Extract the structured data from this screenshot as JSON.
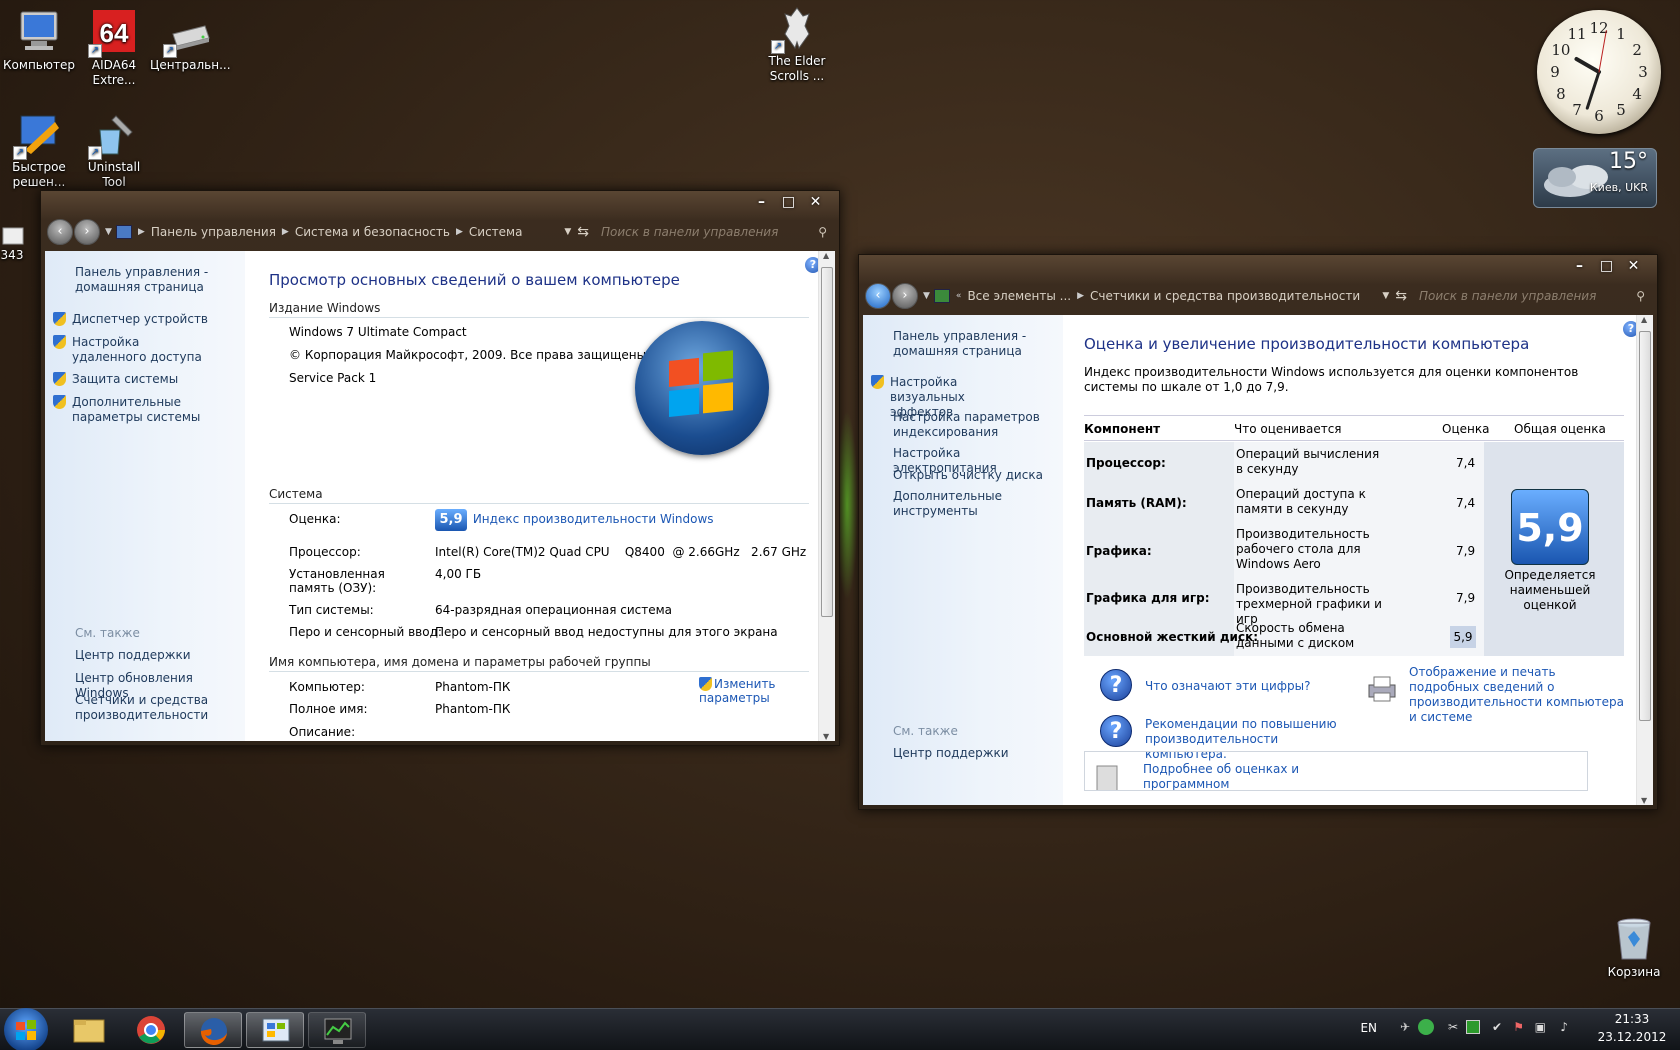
{
  "desktop": {
    "icons": [
      {
        "label": "Компьютер",
        "icon": "computer-icon"
      },
      {
        "label": "AIDA64 Extre...",
        "icon": "aida64-icon"
      },
      {
        "label": "Центральн...",
        "icon": "drive-icon"
      },
      {
        "label": "The Elder Scrolls ...",
        "icon": "skyrim-icon"
      },
      {
        "label": "Быстрое решен...",
        "icon": "quick-fix-icon"
      },
      {
        "label": "Uninstall Tool",
        "icon": "uninstall-tool-icon"
      },
      {
        "label": "343",
        "icon": "file-icon"
      },
      {
        "label": "Корзина",
        "icon": "recycle-bin-icon"
      }
    ],
    "clock_numbers": [
      "12",
      "1",
      "2",
      "3",
      "4",
      "5",
      "6",
      "7",
      "8",
      "9",
      "10",
      "11"
    ],
    "weather": {
      "temp": "15°",
      "city": "Киев, UKR"
    }
  },
  "system_window": {
    "breadcrumbs": [
      "Панель управления",
      "Система и безопасность",
      "Система"
    ],
    "search_placeholder": "Поиск в панели управления",
    "left": {
      "home": "Панель управления - домашняя страница",
      "tasks": [
        "Диспетчер устройств",
        "Настройка удаленного доступа",
        "Защита системы",
        "Дополнительные параметры системы"
      ],
      "see_also": "См. также",
      "see_also_links": [
        "Центр поддержки",
        "Центр обновления Windows",
        "Счетчики и средства производительности"
      ]
    },
    "title": "Просмотр основных сведений о вашем компьютере",
    "edition_header": "Издание Windows",
    "edition": "Windows 7 Ultimate Compact",
    "copyright": "© Корпорация Майкрософт, 2009. Все права защищены.",
    "service_pack": "Service Pack 1",
    "system_header": "Система",
    "rating_label": "Оценка:",
    "rating_value": "5,9",
    "rating_link": "Индекс производительности Windows",
    "cpu_label": "Процессор:",
    "cpu_value": "Intel(R) Core(TM)2 Quad CPU    Q8400  @ 2.66GHz   2.67 GHz",
    "ram_label": "Установленная память (ОЗУ):",
    "ram_value": "4,00 ГБ",
    "type_label": "Тип системы:",
    "type_value": "64-разрядная операционная система",
    "pen_label": "Перо и сенсорный ввод:",
    "pen_value": "Перо и сенсорный ввод недоступны для этого экрана",
    "name_header": "Имя компьютера, имя домена и параметры рабочей группы",
    "computer_label": "Компьютер:",
    "computer_value": "Phantom-ПК",
    "fullname_label": "Полное имя:",
    "fullname_value": "Phantom-ПК",
    "desc_label": "Описание:",
    "change_link": "Изменить параметры"
  },
  "perf_window": {
    "breadcrumbs": [
      "Все элементы ...",
      "Счетчики и средства производительности"
    ],
    "search_placeholder": "Поиск в панели управления",
    "left": {
      "home": "Панель управления - домашняя страница",
      "tasks": [
        "Настройка визуальных эффектов",
        "Настройка параметров индексирования",
        "Настройка электропитания",
        "Открыть очистку диска",
        "Дополнительные инструменты"
      ],
      "see_also": "См. также",
      "see_also_links": [
        "Центр поддержки"
      ]
    },
    "title": "Оценка и увеличение производительности компьютера",
    "intro": "Индекс производительности Windows используется для оценки компонентов системы по шкале от 1,0 до 7,9.",
    "headers": [
      "Компонент",
      "Что оценивается",
      "Оценка",
      "Общая оценка"
    ],
    "rows": [
      {
        "component": "Процессор:",
        "what": "Операций вычисления в секунду",
        "score": "7,4"
      },
      {
        "component": "Память (RAM):",
        "what": "Операций доступа к памяти в секунду",
        "score": "7,4"
      },
      {
        "component": "Графика:",
        "what": "Производительность рабочего стола для Windows Aero",
        "score": "7,9"
      },
      {
        "component": "Графика для игр:",
        "what": "Производительность трехмерной графики и игр",
        "score": "7,9"
      },
      {
        "component": "Основной жесткий диск:",
        "what": "Скорость обмена данными с диском",
        "score": "5,9"
      }
    ],
    "base_score": "5,9",
    "base_caption": "Определяется наименьшей оценкой",
    "link_meaning": "Что означают эти цифры?",
    "link_tips": "Рекомендации по повышению производительности компьютера.",
    "link_print": "Отображение и печать подробных сведений о производительности компьютера и системе",
    "link_more": "Подробнее об оценках и программном обеспечении (в"
  },
  "taskbar": {
    "lang": "EN",
    "time": "21:33",
    "date": "23.12.2012"
  }
}
